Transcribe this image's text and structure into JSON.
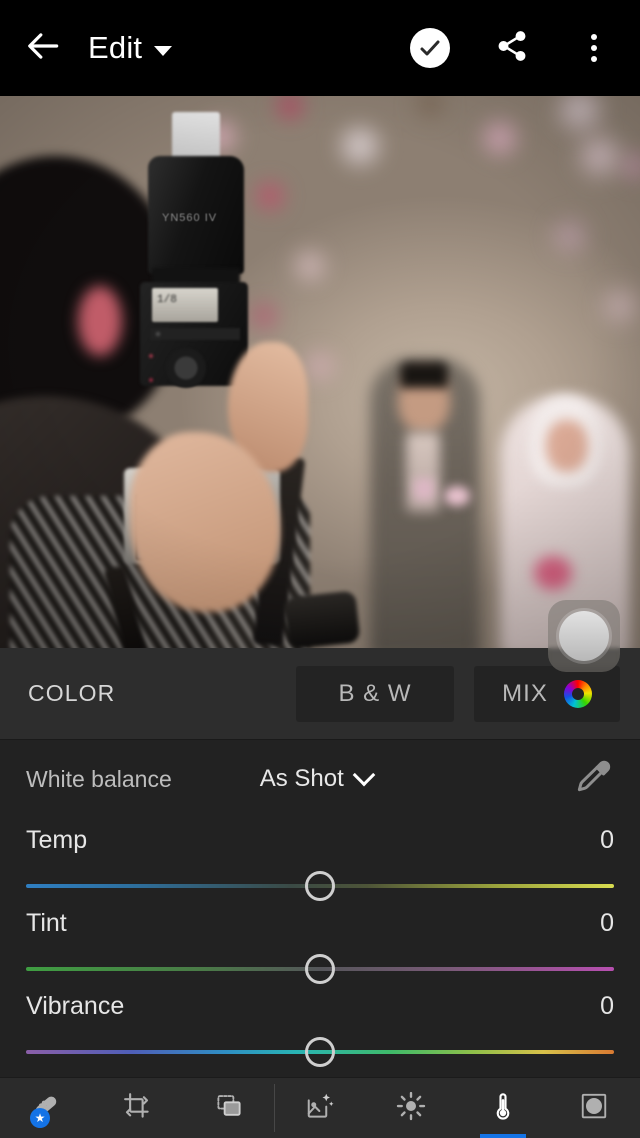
{
  "topbar": {
    "back_icon": "arrow-left-icon",
    "title": "Edit",
    "title_caret_icon": "chevron-down-icon",
    "done_icon": "check-circle-icon",
    "share_icon": "share-icon",
    "more_icon": "overflow-menu-icon"
  },
  "photo": {
    "alt": "Photographer holding camera with YN560 IV flash photographing a wedding couple",
    "flash_label": "YN560 IV",
    "flash_lcd_value": "1/8",
    "compare_button": "before-after-button"
  },
  "color_header": {
    "title": "COLOR",
    "bw_label": "B & W",
    "mix_label": "MIX",
    "mix_icon": "color-wheel-icon"
  },
  "white_balance": {
    "label": "White balance",
    "value": "As Shot",
    "caret_icon": "chevron-down-icon",
    "eyedropper_icon": "eyedropper-icon"
  },
  "sliders": [
    {
      "name": "Temp",
      "value": "0",
      "position_percent": 50,
      "gradient_from": "#2f7fc2",
      "gradient_to": "#d8dc50"
    },
    {
      "name": "Tint",
      "value": "0",
      "position_percent": 50,
      "gradient_from": "#3f9e42",
      "gradient_to": "#b74fb0"
    },
    {
      "name": "Vibrance",
      "value": "0",
      "position_percent": 50,
      "gradient_from": "#8b5fa8",
      "gradient_to": "#d97a32"
    }
  ],
  "toolbar": {
    "active_color": "#1473e6",
    "items": [
      {
        "icon": "healing-brush-icon",
        "name": "healing",
        "badge": "★",
        "active": false
      },
      {
        "icon": "crop-rotate-icon",
        "name": "crop",
        "badge": "",
        "active": false
      },
      {
        "icon": "versions-layers-icon",
        "name": "versions",
        "badge": "",
        "active": false
      },
      {
        "icon": "presets-sparkle-icon",
        "name": "presets",
        "badge": "",
        "active": false
      },
      {
        "icon": "light-sun-icon",
        "name": "light",
        "badge": "",
        "active": false
      },
      {
        "icon": "thermometer-icon",
        "name": "color",
        "badge": "",
        "active": true
      },
      {
        "icon": "vignette-effects-icon",
        "name": "effects",
        "badge": "",
        "active": false
      }
    ]
  }
}
